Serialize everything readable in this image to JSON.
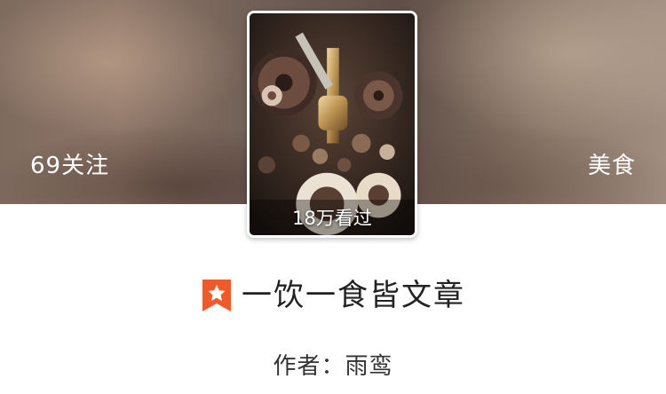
{
  "header": {
    "follow_count": "69关注",
    "category": "美食"
  },
  "cover": {
    "views": "18万看过",
    "image_icon": "steampunk-gears-cover-image"
  },
  "book": {
    "title": "一饮一食皆文章",
    "badge_icon": "bookmark-star-icon",
    "badge_color": "#f05a2a",
    "author_label": "作者：",
    "author_name": "雨鸾"
  }
}
